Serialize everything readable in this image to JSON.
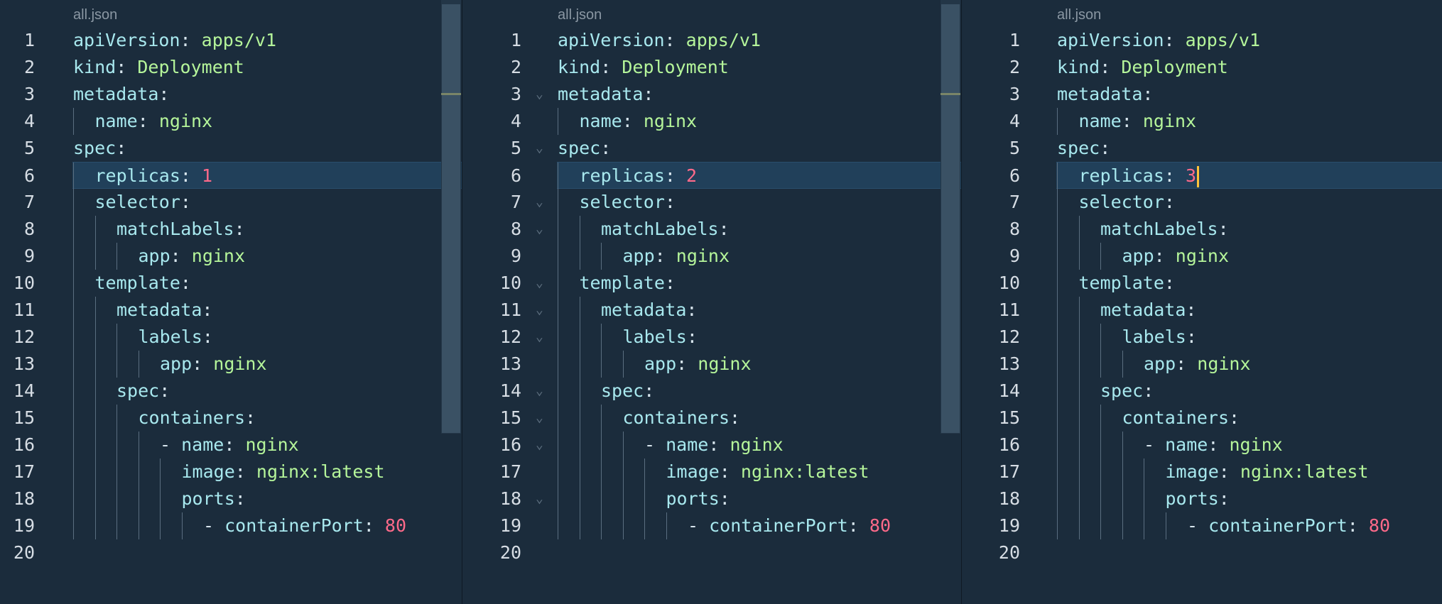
{
  "panes": [
    {
      "file_tab": "all.json",
      "show_folds": false,
      "has_caret": false,
      "lines": [
        {
          "num": "1",
          "indent": 0,
          "key": "apiVersion",
          "val": "apps/v1",
          "vtype": "v"
        },
        {
          "num": "2",
          "indent": 0,
          "key": "kind",
          "val": "Deployment",
          "vtype": "v"
        },
        {
          "num": "3",
          "indent": 0,
          "key": "metadata",
          "val": "",
          "vtype": "v",
          "fold": true
        },
        {
          "num": "4",
          "indent": 1,
          "key": "name",
          "val": "nginx",
          "vtype": "v"
        },
        {
          "num": "5",
          "indent": 0,
          "key": "spec",
          "val": "",
          "vtype": "v",
          "fold": true
        },
        {
          "num": "6",
          "indent": 1,
          "key": "replicas",
          "val": "1",
          "vtype": "n",
          "current": true
        },
        {
          "num": "7",
          "indent": 1,
          "key": "selector",
          "val": "",
          "vtype": "v",
          "fold": true
        },
        {
          "num": "8",
          "indent": 2,
          "key": "matchLabels",
          "val": "",
          "vtype": "v",
          "fold": true
        },
        {
          "num": "9",
          "indent": 3,
          "key": "app",
          "val": "nginx",
          "vtype": "v"
        },
        {
          "num": "10",
          "indent": 1,
          "key": "template",
          "val": "",
          "vtype": "v",
          "fold": true
        },
        {
          "num": "11",
          "indent": 2,
          "key": "metadata",
          "val": "",
          "vtype": "v",
          "fold": true
        },
        {
          "num": "12",
          "indent": 3,
          "key": "labels",
          "val": "",
          "vtype": "v",
          "fold": true
        },
        {
          "num": "13",
          "indent": 4,
          "key": "app",
          "val": "nginx",
          "vtype": "v"
        },
        {
          "num": "14",
          "indent": 2,
          "key": "spec",
          "val": "",
          "vtype": "v",
          "fold": true
        },
        {
          "num": "15",
          "indent": 3,
          "key": "containers",
          "val": "",
          "vtype": "v",
          "fold": true
        },
        {
          "num": "16",
          "indent": 4,
          "dash": true,
          "key": "name",
          "val": "nginx",
          "vtype": "v",
          "fold": true
        },
        {
          "num": "17",
          "indent": 5,
          "key": "image",
          "val": "nginx:latest",
          "vtype": "v"
        },
        {
          "num": "18",
          "indent": 5,
          "key": "ports",
          "val": "",
          "vtype": "v",
          "fold": true
        },
        {
          "num": "19",
          "indent": 6,
          "dash": true,
          "key": "containerPort",
          "val": "80",
          "vtype": "n"
        },
        {
          "num": "20",
          "indent": 0,
          "key": "",
          "val": "",
          "vtype": "v"
        }
      ]
    },
    {
      "file_tab": "all.json",
      "show_folds": true,
      "has_caret": false,
      "lines": [
        {
          "num": "1",
          "indent": 0,
          "key": "apiVersion",
          "val": "apps/v1",
          "vtype": "v"
        },
        {
          "num": "2",
          "indent": 0,
          "key": "kind",
          "val": "Deployment",
          "vtype": "v"
        },
        {
          "num": "3",
          "indent": 0,
          "key": "metadata",
          "val": "",
          "vtype": "v",
          "fold": true
        },
        {
          "num": "4",
          "indent": 1,
          "key": "name",
          "val": "nginx",
          "vtype": "v"
        },
        {
          "num": "5",
          "indent": 0,
          "key": "spec",
          "val": "",
          "vtype": "v",
          "fold": true
        },
        {
          "num": "6",
          "indent": 1,
          "key": "replicas",
          "val": "2",
          "vtype": "n",
          "current": true
        },
        {
          "num": "7",
          "indent": 1,
          "key": "selector",
          "val": "",
          "vtype": "v",
          "fold": true
        },
        {
          "num": "8",
          "indent": 2,
          "key": "matchLabels",
          "val": "",
          "vtype": "v",
          "fold": true
        },
        {
          "num": "9",
          "indent": 3,
          "key": "app",
          "val": "nginx",
          "vtype": "v"
        },
        {
          "num": "10",
          "indent": 1,
          "key": "template",
          "val": "",
          "vtype": "v",
          "fold": true
        },
        {
          "num": "11",
          "indent": 2,
          "key": "metadata",
          "val": "",
          "vtype": "v",
          "fold": true
        },
        {
          "num": "12",
          "indent": 3,
          "key": "labels",
          "val": "",
          "vtype": "v",
          "fold": true
        },
        {
          "num": "13",
          "indent": 4,
          "key": "app",
          "val": "nginx",
          "vtype": "v"
        },
        {
          "num": "14",
          "indent": 2,
          "key": "spec",
          "val": "",
          "vtype": "v",
          "fold": true
        },
        {
          "num": "15",
          "indent": 3,
          "key": "containers",
          "val": "",
          "vtype": "v",
          "fold": true
        },
        {
          "num": "16",
          "indent": 4,
          "dash": true,
          "key": "name",
          "val": "nginx",
          "vtype": "v",
          "fold": true
        },
        {
          "num": "17",
          "indent": 5,
          "key": "image",
          "val": "nginx:latest",
          "vtype": "v"
        },
        {
          "num": "18",
          "indent": 5,
          "key": "ports",
          "val": "",
          "vtype": "v",
          "fold": true
        },
        {
          "num": "19",
          "indent": 6,
          "dash": true,
          "key": "containerPort",
          "val": "80",
          "vtype": "n"
        },
        {
          "num": "20",
          "indent": 0,
          "key": "",
          "val": "",
          "vtype": "v"
        }
      ]
    },
    {
      "file_tab": "all.json",
      "show_folds": false,
      "has_caret": true,
      "lines": [
        {
          "num": "1",
          "indent": 0,
          "key": "apiVersion",
          "val": "apps/v1",
          "vtype": "v"
        },
        {
          "num": "2",
          "indent": 0,
          "key": "kind",
          "val": "Deployment",
          "vtype": "v"
        },
        {
          "num": "3",
          "indent": 0,
          "key": "metadata",
          "val": "",
          "vtype": "v",
          "fold": true
        },
        {
          "num": "4",
          "indent": 1,
          "key": "name",
          "val": "nginx",
          "vtype": "v"
        },
        {
          "num": "5",
          "indent": 0,
          "key": "spec",
          "val": "",
          "vtype": "v",
          "fold": true
        },
        {
          "num": "6",
          "indent": 1,
          "key": "replicas",
          "val": "3",
          "vtype": "n",
          "current": true
        },
        {
          "num": "7",
          "indent": 1,
          "key": "selector",
          "val": "",
          "vtype": "v",
          "fold": true
        },
        {
          "num": "8",
          "indent": 2,
          "key": "matchLabels",
          "val": "",
          "vtype": "v",
          "fold": true
        },
        {
          "num": "9",
          "indent": 3,
          "key": "app",
          "val": "nginx",
          "vtype": "v"
        },
        {
          "num": "10",
          "indent": 1,
          "key": "template",
          "val": "",
          "vtype": "v",
          "fold": true
        },
        {
          "num": "11",
          "indent": 2,
          "key": "metadata",
          "val": "",
          "vtype": "v",
          "fold": true
        },
        {
          "num": "12",
          "indent": 3,
          "key": "labels",
          "val": "",
          "vtype": "v",
          "fold": true
        },
        {
          "num": "13",
          "indent": 4,
          "key": "app",
          "val": "nginx",
          "vtype": "v"
        },
        {
          "num": "14",
          "indent": 2,
          "key": "spec",
          "val": "",
          "vtype": "v",
          "fold": true
        },
        {
          "num": "15",
          "indent": 3,
          "key": "containers",
          "val": "",
          "vtype": "v",
          "fold": true
        },
        {
          "num": "16",
          "indent": 4,
          "dash": true,
          "key": "name",
          "val": "nginx",
          "vtype": "v",
          "fold": true
        },
        {
          "num": "17",
          "indent": 5,
          "key": "image",
          "val": "nginx:latest",
          "vtype": "v"
        },
        {
          "num": "18",
          "indent": 5,
          "key": "ports",
          "val": "",
          "vtype": "v",
          "fold": true
        },
        {
          "num": "19",
          "indent": 6,
          "dash": true,
          "key": "containerPort",
          "val": "80",
          "vtype": "n"
        },
        {
          "num": "20",
          "indent": 0,
          "key": "",
          "val": "",
          "vtype": "v"
        }
      ]
    }
  ]
}
